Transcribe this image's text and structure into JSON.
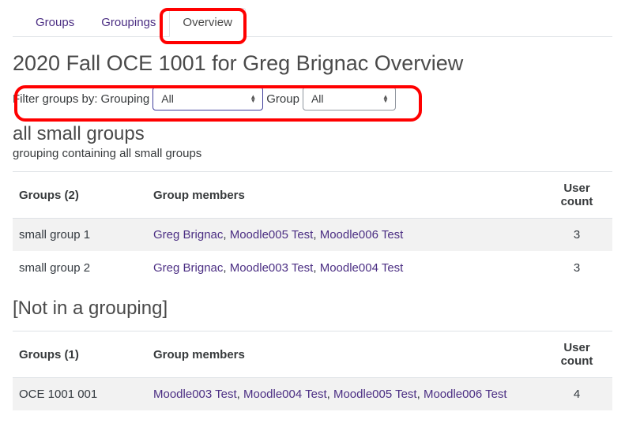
{
  "tabs": [
    {
      "label": "Groups",
      "active": false
    },
    {
      "label": "Groupings",
      "active": false
    },
    {
      "label": "Overview",
      "active": true
    }
  ],
  "page_title": "2020 Fall OCE 1001 for Greg Brignac Overview",
  "filter": {
    "prefix": "Filter groups by:",
    "grouping_label": "Grouping",
    "grouping_value": "All",
    "group_label": "Group",
    "group_value": "All"
  },
  "sections": [
    {
      "title": "all small groups",
      "desc": "grouping containing all small groups",
      "groups_header": "Groups (2)",
      "members_header": "Group members",
      "count_header_l1": "User",
      "count_header_l2": "count",
      "rows": [
        {
          "name": "small group 1",
          "members": [
            "Greg Brignac",
            "Moodle005 Test",
            "Moodle006 Test"
          ],
          "count": 3
        },
        {
          "name": "small group 2",
          "members": [
            "Greg Brignac",
            "Moodle003 Test",
            "Moodle004 Test"
          ],
          "count": 3
        }
      ]
    },
    {
      "title": "[Not in a grouping]",
      "desc": null,
      "groups_header": "Groups (1)",
      "members_header": "Group members",
      "count_header_l1": "User",
      "count_header_l2": "count",
      "rows": [
        {
          "name": "OCE 1001 001",
          "members": [
            "Moodle003 Test",
            "Moodle004 Test",
            "Moodle005 Test",
            "Moodle006 Test"
          ],
          "count": 4
        }
      ]
    }
  ]
}
